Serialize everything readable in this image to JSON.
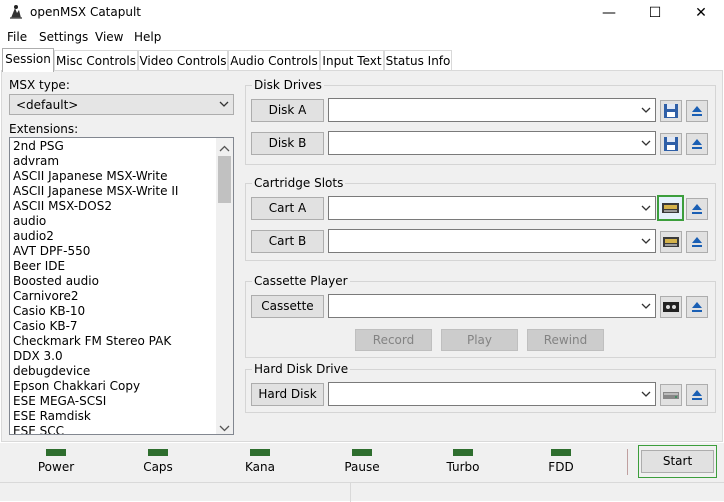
{
  "window": {
    "title": "openMSX Catapult",
    "minimize_glyph": "—",
    "maximize_glyph": "☐",
    "close_glyph": "✕"
  },
  "menu": [
    "File",
    "Settings",
    "View",
    "Help"
  ],
  "tabs": [
    "Session",
    "Misc Controls",
    "Video Controls",
    "Audio Controls",
    "Input Text",
    "Status Info"
  ],
  "session": {
    "msx_type_label": "MSX type:",
    "msx_type_value": "<default>",
    "extensions_label": "Extensions:",
    "extensions": [
      "2nd PSG",
      "advram",
      "ASCII Japanese MSX-Write",
      "ASCII Japanese MSX-Write II",
      "ASCII MSX-DOS2",
      "audio",
      "audio2",
      "AVT DPF-550",
      "Beer IDE",
      "Boosted audio",
      "Carnivore2",
      "Casio KB-10",
      "Casio KB-7",
      "Checkmark FM Stereo PAK",
      "DDX 3.0",
      "debugdevice",
      "Epson Chakkari Copy",
      "ESE MEGA-SCSI",
      "ESE Ramdisk",
      "ESE SCC"
    ]
  },
  "disk_drives": {
    "title": "Disk Drives",
    "disk_a": "Disk A",
    "disk_b": "Disk B"
  },
  "cartridge_slots": {
    "title": "Cartridge Slots",
    "cart_a": "Cart A",
    "cart_b": "Cart B"
  },
  "cassette_player": {
    "title": "Cassette Player",
    "cassette": "Cassette",
    "record": "Record",
    "play": "Play",
    "rewind": "Rewind"
  },
  "hard_disk": {
    "title": "Hard Disk Drive",
    "hard_disk": "Hard Disk"
  },
  "status_leds": [
    "Power",
    "Caps",
    "Kana",
    "Pause",
    "Turbo",
    "FDD"
  ],
  "start_label": "Start",
  "colors": {
    "led": "#2e6e2e",
    "focus": "#3c9e3c",
    "save_icon": "#2f5fa7"
  }
}
